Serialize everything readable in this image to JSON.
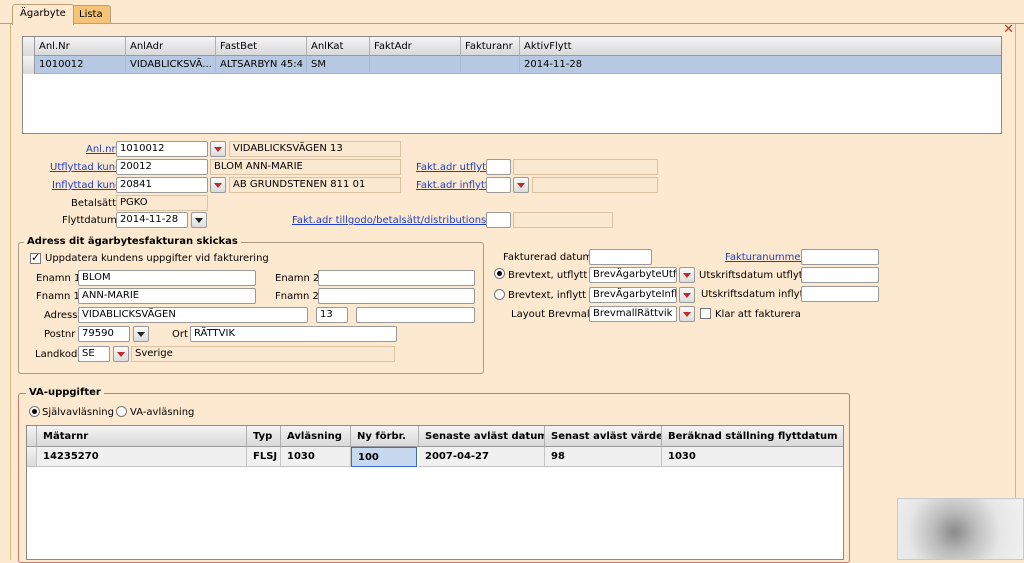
{
  "tabs": [
    {
      "label": "Ägarbyte"
    },
    {
      "label": "Lista"
    }
  ],
  "top_grid": {
    "columns": [
      "Anl.Nr",
      "AnlAdr",
      "FastBet",
      "AnlKat",
      "FaktAdr",
      "Fakturanr",
      "AktivFlytt"
    ],
    "rows": [
      [
        "1010012",
        "VIDABLICKSVÄ...",
        "ALTSARBYN 45:4",
        "SM",
        "",
        "",
        "2014-11-28"
      ]
    ]
  },
  "form": {
    "anlnr": {
      "label": "Anl.nr",
      "value": "1010012",
      "address": "VIDABLICKSVÄGEN 13"
    },
    "utflyttad": {
      "label": "Utflyttad kund",
      "value": "20012",
      "name": "BLOM ANN-MARIE"
    },
    "inflyttad": {
      "label": "Inflyttad kund",
      "value": "20841",
      "name": "AB GRUNDSTENEN 811 01"
    },
    "betalsatt": {
      "label": "Betalsätt",
      "value": "PGKO"
    },
    "flyttdatum": {
      "label": "Flyttdatum",
      "value": "2014-11-28"
    },
    "faktadr_utflytt": {
      "label": "Fakt.adr utflytt",
      "value": "",
      "extra": ""
    },
    "faktadr_inflytt": {
      "label": "Fakt.adr inflytt",
      "value": "",
      "extra": ""
    },
    "faktadr_tillgodo": {
      "label": "Fakt.adr tillgodo/betalsätt/distributionssätt",
      "value": "",
      "extra": ""
    }
  },
  "address_group": {
    "title": "Adress dit ägarbytesfakturan skickas",
    "update_checkbox": {
      "label": "Uppdatera kundens uppgifter vid fakturering",
      "checked": true
    },
    "enamn1": {
      "label": "Enamn 1",
      "value": "BLOM"
    },
    "enamn2": {
      "label": "Enamn 2",
      "value": ""
    },
    "fnamn1": {
      "label": "Fnamn 1",
      "value": "ANN-MARIE"
    },
    "fnamn2": {
      "label": "Fnamn 2",
      "value": ""
    },
    "adress": {
      "label": "Adress",
      "value": "VIDABLICKSVÄGEN",
      "number": "13",
      "extra": ""
    },
    "postnr": {
      "label": "Postnr",
      "value": "79590"
    },
    "ort": {
      "label": "Ort",
      "value": "RÄTTVIK"
    },
    "landkod": {
      "label": "Landkod",
      "value": "SE",
      "country": "Sverige"
    }
  },
  "invoice": {
    "fakturerad_datum": {
      "label": "Fakturerad datum",
      "value": ""
    },
    "fakturanummer": {
      "label": "Fakturanummer",
      "value": ""
    },
    "brevtext_utflytt": {
      "label": "Brevtext, utflytt",
      "value": "BrevÄgarbyteUtfly",
      "selected": true
    },
    "brevtext_inflytt": {
      "label": "Brevtext, inflytt",
      "value": "BrevÄgarbyteInfly",
      "selected": false
    },
    "utskrift_utflytt": {
      "label": "Utskriftsdatum utflytt",
      "value": ""
    },
    "utskrift_inflytt": {
      "label": "Utskriftsdatum inflytt",
      "value": ""
    },
    "layout": {
      "label": "Layout Brevmall",
      "value": "BrevmallRättvik"
    },
    "klar": {
      "label": "Klar att fakturera",
      "checked": false
    }
  },
  "va_group": {
    "title": "VA-uppgifter",
    "radio_self": {
      "label": "Självavläsning",
      "selected": true
    },
    "radio_va": {
      "label": "VA-avläsning",
      "selected": false
    },
    "columns": [
      "Mätarnr",
      "Typ",
      "Avläsning",
      "Ny förbr.",
      "Senaste avläst datum",
      "Senast avläst värde",
      "Beräknad ställning flyttdatum"
    ],
    "rows": [
      [
        "14235270",
        "FLSJ",
        "1030",
        "100",
        "2007-04-27",
        "98",
        "1030"
      ]
    ]
  },
  "colors": {
    "background": "#fde9cf",
    "selected_row": "#b7c9e2",
    "link": "#1f3fc8",
    "dropdown_arrow": "#c62828"
  }
}
